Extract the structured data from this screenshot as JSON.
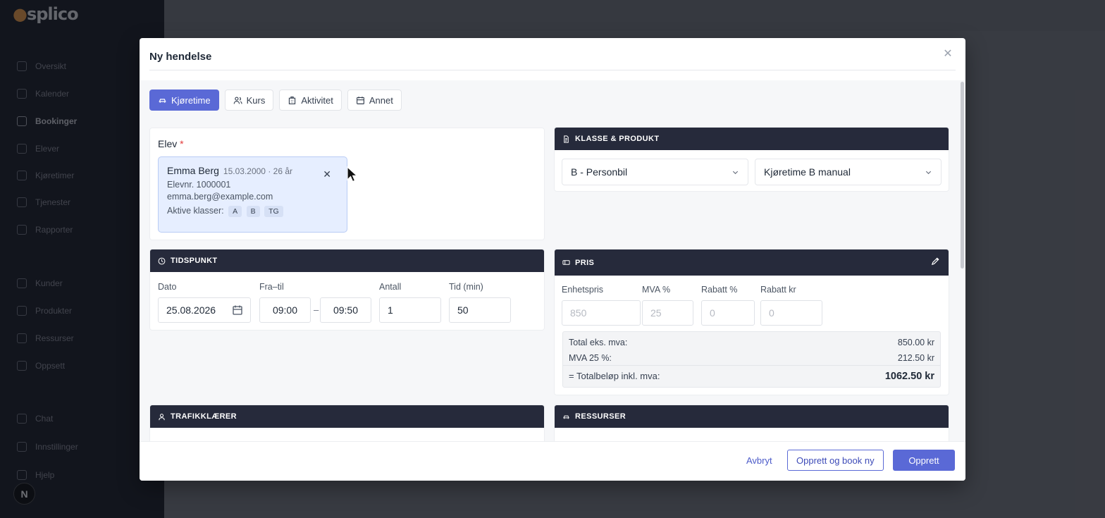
{
  "app": {
    "logo": "splico",
    "nav": [
      {
        "label": "Oversikt"
      },
      {
        "label": "Kalender"
      },
      {
        "label": "Bookinger",
        "active": true
      },
      {
        "label": "Elever"
      },
      {
        "label": "Kjøretimer"
      },
      {
        "label": "Tjenester"
      },
      {
        "label": "Rapporter"
      },
      {
        "label": "Kunder"
      },
      {
        "label": "Produkter"
      },
      {
        "label": "Ressurser"
      },
      {
        "label": "Oppsett"
      },
      {
        "label": "Chat"
      },
      {
        "label": "Innstillinger"
      },
      {
        "label": "Hjelp"
      }
    ],
    "next_badge": "N"
  },
  "modal": {
    "title": "Ny hendelse",
    "tabs": [
      {
        "label": "Kjøretime",
        "active": true
      },
      {
        "label": "Kurs"
      },
      {
        "label": "Aktivitet"
      },
      {
        "label": "Annet"
      }
    ],
    "elev": {
      "label": "Elev",
      "required_mark": "*",
      "student": {
        "name": "Emma Berg",
        "meta": "15.03.2000 · 26 år",
        "student_no": "Elevnr. 1000001",
        "email": "emma.berg@example.com",
        "classes_label": "Aktive klasser:",
        "classes": [
          "A",
          "B",
          "TG"
        ]
      }
    },
    "klasse_produkt": {
      "heading": "KLASSE & PRODUKT",
      "class_select": "B - Personbil",
      "product_select": "Kjøretime B manual"
    },
    "tidspunkt": {
      "heading": "TIDSPUNKT",
      "date_label": "Dato",
      "date_value": "25.08.2026",
      "fromto_label": "Fra–til",
      "from_value": "09:00",
      "dash": "–",
      "to_value": "09:50",
      "count_label": "Antall",
      "count_value": "1",
      "duration_label": "Tid (min)",
      "duration_value": "50"
    },
    "pris": {
      "heading": "PRIS",
      "unit_price_label": "Enhetspris",
      "unit_price_value": "850",
      "vat_label": "MVA %",
      "vat_value": "25",
      "discount_pct_label": "Rabatt %",
      "discount_pct_value": "0",
      "discount_kr_label": "Rabatt kr",
      "discount_kr_value": "0",
      "total_ex_label": "Total eks. mva:",
      "total_ex_value": "850.00 kr",
      "vat_amount_label": "MVA 25 %:",
      "vat_amount_value": "212.50 kr",
      "total_inc_label": "= Totalbeløp inkl. mva:",
      "total_inc_value": "1062.50 kr"
    },
    "trafikklaerer": {
      "heading": "TRAFIKKLÆRER"
    },
    "ressurser": {
      "heading": "RESSURSER"
    },
    "footer": {
      "cancel": "Avbryt",
      "create_and_book": "Opprett og book ny",
      "create": "Opprett"
    }
  },
  "colors": {
    "accent": "#5a69d6",
    "card_header": "#262a3b",
    "student_card_bg": "#e6eeff"
  }
}
